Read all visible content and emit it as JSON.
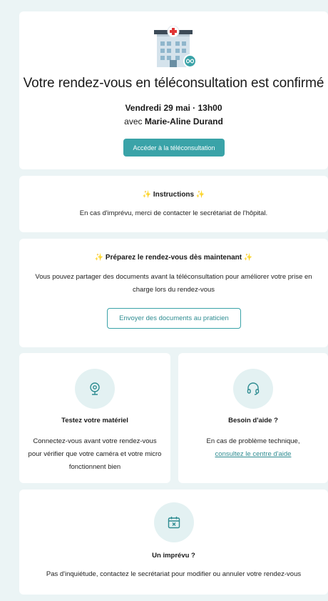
{
  "confirmation": {
    "title": "Votre rendez-vous en téléconsultation est confirmé",
    "date": "Vendredi 29 mai · 13h00",
    "with_prefix": "avec ",
    "doctor": "Marie-Aline Durand",
    "access_button": "Accéder à la téléconsultation",
    "icons": [
      "hospital-icon",
      "teleconsultation-link-icon"
    ]
  },
  "instructions": {
    "spark": "✨",
    "title": "Instructions",
    "text": "En cas d'imprévu, merci de contacter le secrétariat de l'hôpital."
  },
  "prepare": {
    "spark": "✨",
    "title": "Préparez le rendez-vous dès maintenant",
    "text": "Vous pouvez partager des documents avant la téléconsultation pour améliorer votre prise en charge lors du rendez-vous",
    "button": "Envoyer des documents au praticien"
  },
  "test_equipment": {
    "icon": "webcam-icon",
    "title": "Testez votre matériel",
    "text": "Connectez-vous avant votre rendez-vous pour vérifier que votre caméra et votre micro fonctionnent bien"
  },
  "help": {
    "icon": "headset-icon",
    "title": "Besoin d'aide ?",
    "text": "En cas de problème technique,",
    "link": "consultez le centre d'aide"
  },
  "unexpected": {
    "icon": "calendar-cancel-icon",
    "title": "Un imprévu ?",
    "text": "Pas d'inquiétude, contactez le secrétariat pour modifier ou annuler votre rendez-vous"
  },
  "colors": {
    "background": "#ebf4f5",
    "accent": "#3aa3a8",
    "icon_circle": "#e3f1f2",
    "spark": "#f2c14e"
  }
}
